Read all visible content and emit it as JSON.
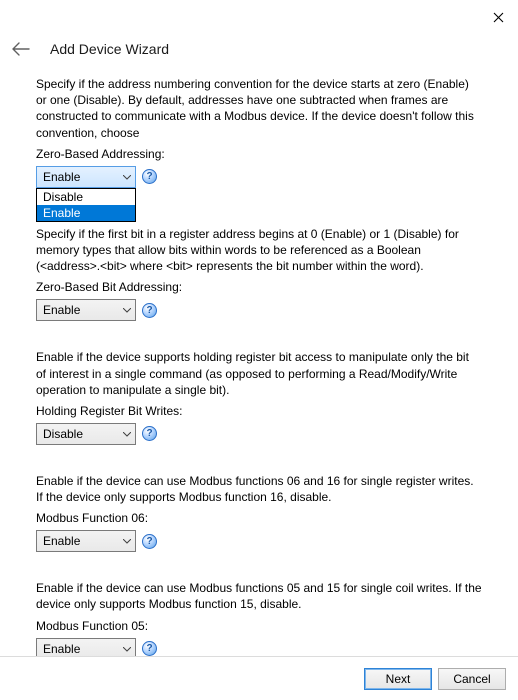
{
  "window": {
    "title": "Add Device Wizard"
  },
  "sections": {
    "zeroBasedAddressing": {
      "desc": "Specify if the address numbering convention for the device starts at zero (Enable) or one (Disable). By default, addresses have one subtracted when frames are constructed to communicate with a Modbus device. If the device doesn't follow this convention, choose",
      "label": "Zero-Based Addressing:",
      "value": "Enable",
      "options": {
        "opt0": "Disable",
        "opt1": "Enable"
      }
    },
    "zeroBasedBit": {
      "desc": "Specify if the first bit in a register address begins at 0 (Enable) or 1 (Disable) for memory types that allow bits within words to be referenced as a Boolean (<address>.<bit> where <bit> represents the bit number within the word).",
      "label": "Zero-Based Bit Addressing:",
      "value": "Enable"
    },
    "holdingRegBitWrites": {
      "desc": "Enable if the device supports holding register bit access to manipulate only the bit of interest in a single command (as opposed to performing a Read/Modify/Write operation to manipulate a single bit).",
      "label": "Holding Register Bit Writes:",
      "value": "Disable"
    },
    "modbusFn06": {
      "desc": "Enable if the device can use Modbus functions 06 and 16 for single register writes. If the device only supports Modbus function 16, disable.",
      "label": "Modbus Function 06:",
      "value": "Enable"
    },
    "modbusFn05": {
      "desc": "Enable if the device can use Modbus functions 05 and 15 for single coil writes. If the device only supports Modbus function 15, disable.",
      "label": "Modbus Function 05:",
      "value": "Enable"
    }
  },
  "footer": {
    "next": "Next",
    "cancel": "Cancel"
  }
}
